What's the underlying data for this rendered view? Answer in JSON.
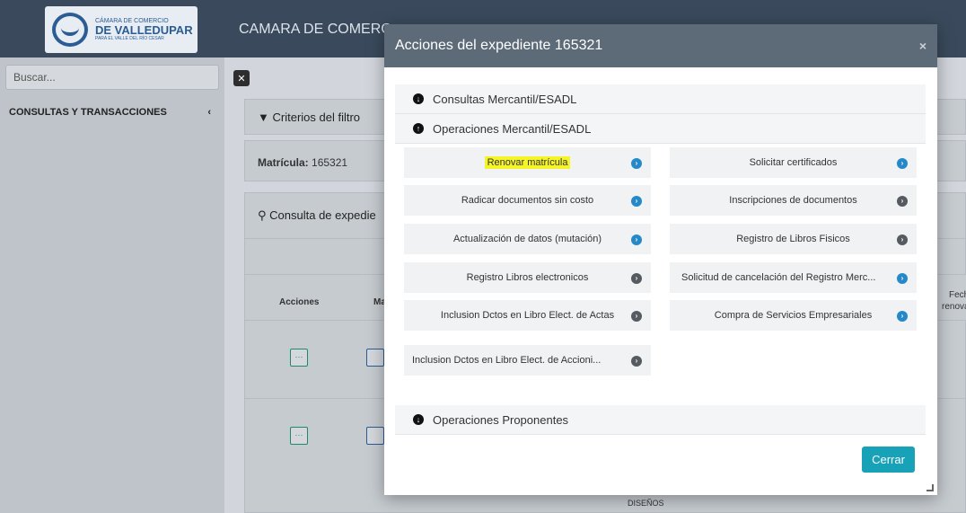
{
  "app": {
    "logo_line1": "CÁMARA DE COMERCIO",
    "logo_line2": "DE VALLEDUPAR",
    "logo_line3": "PARA EL VALLE DEL RÍO CESAR",
    "title": "CAMARA DE COMERC"
  },
  "sidebar": {
    "search_placeholder": "Buscar...",
    "menu_label": "CONSULTAS Y TRANSACCIONES",
    "menu_chevron": "‹"
  },
  "main": {
    "filter_header": "Criterios del filtro",
    "matricula_label": "Matrícula:",
    "matricula_value": "165321",
    "consulta_header": "Consulta de expedie",
    "col_acciones": "Acciones",
    "col_ma": "Ma",
    "col_fecha": "Fech",
    "col_renova": "renova",
    "cell_disenos": "DISEÑOS",
    "row_btn": "···"
  },
  "modal": {
    "title": "Acciones del expediente 165321",
    "close": "×",
    "sections": {
      "consultas": "Consultas Mercantil/ESADL",
      "operaciones": "Operaciones Mercantil/ESADL",
      "proponentes": "Operaciones Proponentes"
    },
    "operations": [
      {
        "label": "Renovar matrícula",
        "status": "blue",
        "highlight": true
      },
      {
        "label": "Solicitar certificados",
        "status": "blue"
      },
      {
        "label": "Radicar documentos sin costo",
        "status": "blue"
      },
      {
        "label": "Inscripciones de documentos",
        "status": "dark"
      },
      {
        "label": "Actualización de datos (mutación)",
        "status": "blue"
      },
      {
        "label": "Registro de Libros Fisicos",
        "status": "dark"
      },
      {
        "label": "Registro Libros electronicos",
        "status": "dark"
      },
      {
        "label": "Solicitud de cancelación del Registro Merc...",
        "status": "blue"
      },
      {
        "label": "Inclusion Dctos en Libro Elect. de Actas",
        "status": "dark"
      },
      {
        "label": "Compra de Servicios Empresariales",
        "status": "blue"
      },
      {
        "label": "Inclusion Dctos en Libro Elect. de Accioni...",
        "status": "dark"
      }
    ],
    "close_button": "Cerrar"
  },
  "colors": {
    "header": "#5d6b79",
    "status_blue": "#2589c9",
    "status_dark": "#555b61",
    "primary_button": "#17a2b8",
    "highlight": "#f4f428"
  },
  "icons": {
    "section_collapsed": "circle-arrow-down-icon",
    "section_expanded": "circle-arrow-up-icon",
    "operation_go": "chevron-right-circle-icon"
  }
}
